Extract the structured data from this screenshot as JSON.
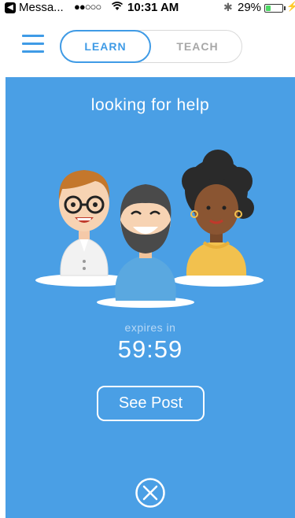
{
  "status_bar": {
    "back_app": "Messa...",
    "signal": "●●○○○",
    "time": "10:31 AM",
    "battery_percent": "29%",
    "battery_level": 0.29,
    "icons": [
      "back-arrow-icon",
      "wifi-icon",
      "bluetooth-icon",
      "battery-icon",
      "charging-icon"
    ]
  },
  "nav": {
    "menu_icon": "hamburger-menu-icon",
    "tabs": [
      {
        "label": "LEARN",
        "selected": true
      },
      {
        "label": "TEACH",
        "selected": false
      }
    ]
  },
  "main": {
    "headline": "looking for help",
    "expires_label": "expires in",
    "countdown": "59:59",
    "see_post_label": "See Post",
    "close_icon": "close-circle-icon"
  },
  "colors": {
    "accent": "#3f9be6",
    "background_blue": "#4a9fe5",
    "inactive_tab": "#a7a7a7"
  }
}
